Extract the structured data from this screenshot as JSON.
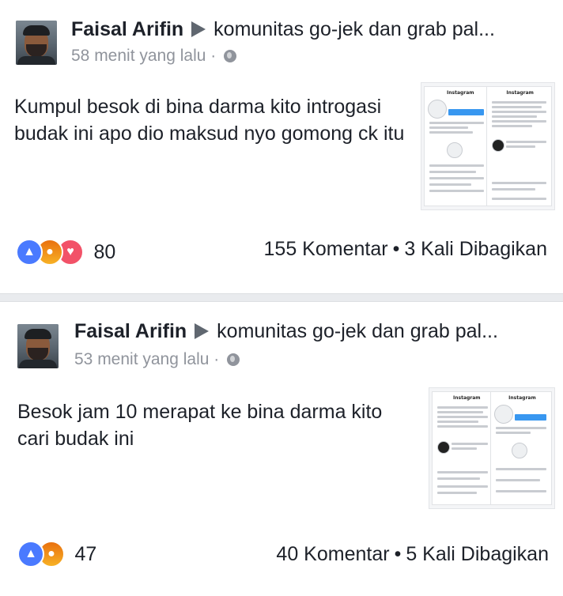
{
  "posts": [
    {
      "author": "Faisal Arifin",
      "group": "komunitas go-jek dan grab pal...",
      "time": "58 menit yang lalu",
      "privacy_separator": "·",
      "privacy_icon": "globe-icon",
      "text": "Kumpul besok di bina darma kito introgasi budak ini apo dio maksud nyo gomong ck itu",
      "reactions": [
        "like",
        "angry",
        "love"
      ],
      "reaction_count": "80",
      "comments": "155 Komentar",
      "separator": "•",
      "shares": "3 Kali Dibagikan",
      "thumb_label": "Instagram"
    },
    {
      "author": "Faisal Arifin",
      "group": "komunitas go-jek dan grab pal...",
      "time": "53 menit yang lalu",
      "privacy_separator": "·",
      "privacy_icon": "globe-icon",
      "text": "Besok jam 10 merapat ke bina darma kito cari budak ini",
      "reactions": [
        "like",
        "angry"
      ],
      "reaction_count": "47",
      "comments": "40 Komentar",
      "separator": "•",
      "shares": "5 Kali Dibagikan",
      "thumb_label": "Instagram"
    }
  ],
  "colors": {
    "like": "#4a7aff",
    "angry": "#f0891a",
    "love": "#f25268",
    "meta": "#90949c",
    "text": "#1d2129",
    "divider": "#e9ebee"
  }
}
